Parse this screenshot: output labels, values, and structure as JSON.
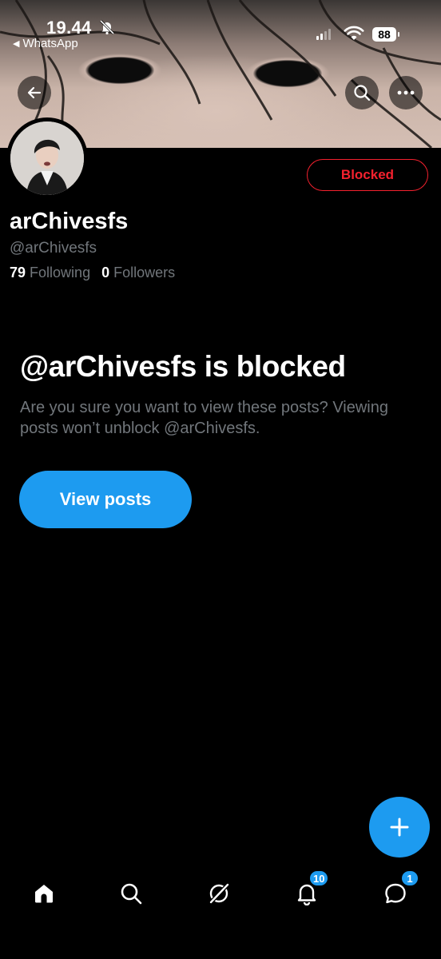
{
  "status_bar": {
    "time": "19.44",
    "back_app": "WhatsApp",
    "battery": "88"
  },
  "profile": {
    "display_name": "arChivesfs",
    "handle": "@arChivesfs",
    "following_count": "79",
    "following_label": "Following",
    "followers_count": "0",
    "followers_label": "Followers",
    "relationship_button": "Blocked"
  },
  "blocked_notice": {
    "title": "@arChivesfs is blocked",
    "subtitle": "Are you sure you want to view these posts? Viewing posts won’t unblock @arChivesfs.",
    "button": "View posts"
  },
  "tabbar": {
    "items": [
      {
        "icon": "home-icon"
      },
      {
        "icon": "search-icon"
      },
      {
        "icon": "grok-icon"
      },
      {
        "icon": "bell-icon",
        "badge": "10"
      },
      {
        "icon": "messages-icon",
        "badge": "1"
      }
    ]
  },
  "colors": {
    "accent": "#1d9bf0",
    "danger": "#f4212e",
    "secondary_text": "#71767b",
    "background": "#000000"
  }
}
